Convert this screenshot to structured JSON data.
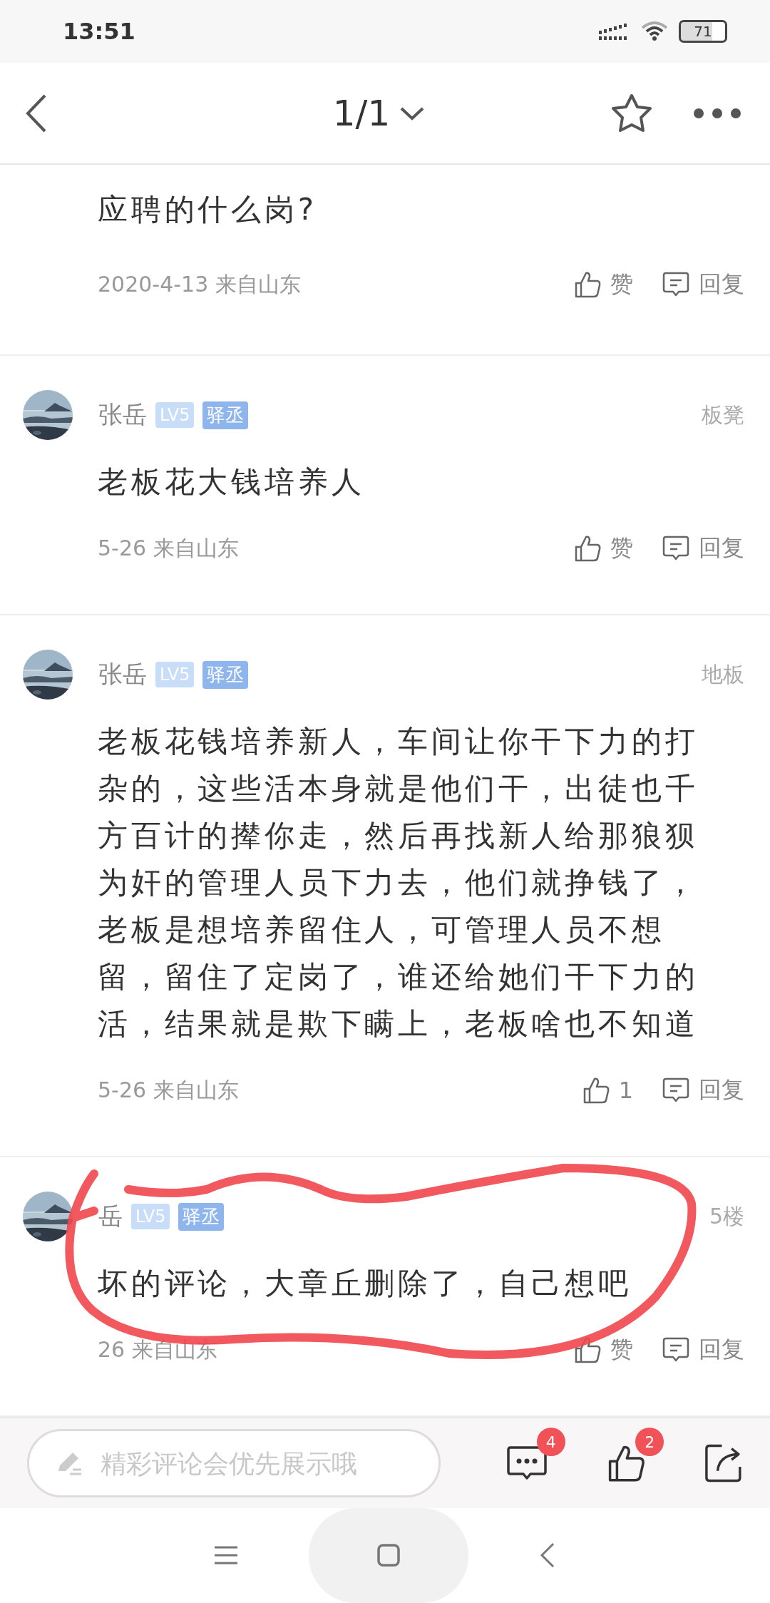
{
  "status_bar": {
    "time": "13:51",
    "battery": "71"
  },
  "header": {
    "title": "1/1"
  },
  "comments": [
    {
      "kind": "partial",
      "text": "应聘的什么岗?",
      "date": "2020-4-13 来自山东",
      "like": "赞",
      "reply": "回复"
    },
    {
      "kind": "full",
      "name": "张岳",
      "level": "LV5",
      "title": "驿丞",
      "floor": "板凳",
      "text": "老板花大钱培养人",
      "date": "5-26 来自山东",
      "like": "赞",
      "reply": "回复"
    },
    {
      "kind": "full",
      "name": "张岳",
      "level": "LV5",
      "title": "驿丞",
      "floor": "地板",
      "text": "老板花钱培养新人，车间让你干下力的打杂的，这些活本身就是他们干，出徒也千方百计的撵你走，然后再找新人给那狼狈为奸的管理人员下力去，他们就挣钱了，老板是想培养留住人，可管理人员不想留，留住了定岗了，谁还给她们干下力的活，结果就是欺下瞒上，老板啥也不知道",
      "date": "5-26 来自山东",
      "like": "1",
      "reply": "回复"
    },
    {
      "kind": "full",
      "name": "岳",
      "level": "LV5",
      "title": "驿丞",
      "floor": "5楼",
      "text": "坏的评论，大章丘删除了，自己想吧",
      "date": "26 来自山东",
      "like": "赞",
      "reply": "回复"
    }
  ],
  "bottom_bar": {
    "placeholder": "精彩评论会优先展示哦",
    "comment_count": "4",
    "like_count": "2"
  }
}
